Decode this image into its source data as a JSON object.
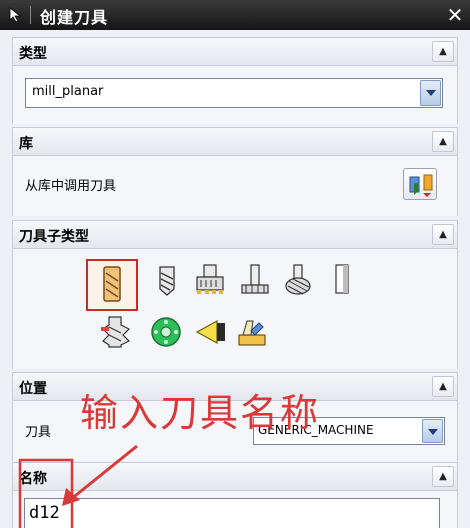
{
  "title": "创建刀具",
  "sections": {
    "type": {
      "header": "类型",
      "select_value": "mill_planar"
    },
    "library": {
      "header": "库",
      "label": "从库中调用刀具"
    },
    "subtype": {
      "header": "刀具子类型",
      "tools_row1": [
        "end-mill-tool-icon",
        "drill-mill-tool-icon",
        "face-mill-tool-icon",
        "t-cutter-tool-icon",
        "barrel-tool-icon",
        "thread-mill-tool-icon"
      ],
      "tools_row2": [
        "formed-tool-icon",
        "disk-tool-icon",
        "probe-tool-icon",
        "user-defined-tool-icon"
      ],
      "selected_index": 0
    },
    "position": {
      "header": "位置",
      "tool_label": "刀具",
      "tool_select_value": "GENERIC_MACHINE"
    },
    "name": {
      "header": "名称",
      "value": "d12"
    }
  },
  "annotation": {
    "text": "输入刀具名称",
    "color": "#d83a3a"
  },
  "colors": {
    "titlebar": "#1f1f1f",
    "panel": "#f5f6fa",
    "highlight": "#c82b2b"
  }
}
